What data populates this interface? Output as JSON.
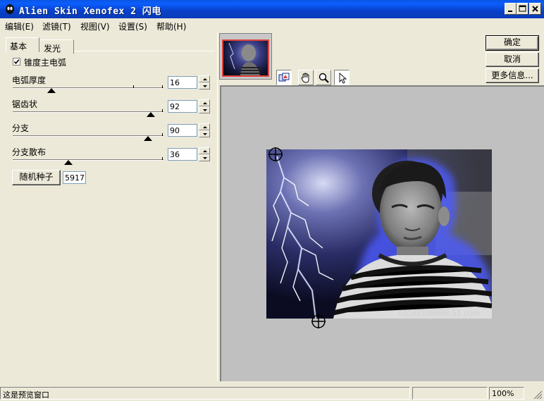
{
  "window": {
    "title": "Alien Skin Xenofex 2 闪电"
  },
  "menu": [
    "编辑(E)",
    "滤镜(T)",
    "视图(V)",
    "设置(S)",
    "帮助(H)"
  ],
  "tabs": [
    "基本",
    "发光"
  ],
  "checkbox": {
    "label": "锥度主电弧",
    "checked": true
  },
  "sliders": [
    {
      "label": "电弧厚度",
      "value": "16",
      "position": 0.23
    },
    {
      "label": "锯齿状",
      "value": "92",
      "position": 0.92
    },
    {
      "label": "分支",
      "value": "90",
      "position": 0.9
    },
    {
      "label": "分支散布",
      "value": "36",
      "position": 0.36
    }
  ],
  "seed": {
    "button_label": "随机种子",
    "value": "5917"
  },
  "buttons": {
    "ok": "确定",
    "cancel": "取消",
    "more_info": "更多信息..."
  },
  "watermark": "Gj168168888.51.com",
  "status": {
    "message": "这是预览窗口",
    "zoom": "100%"
  },
  "colors": {
    "titlebar": "#0a55e3",
    "face": "#ece9d8",
    "preview_bg": "#c0c0c0",
    "glow": "#4d5cff"
  }
}
